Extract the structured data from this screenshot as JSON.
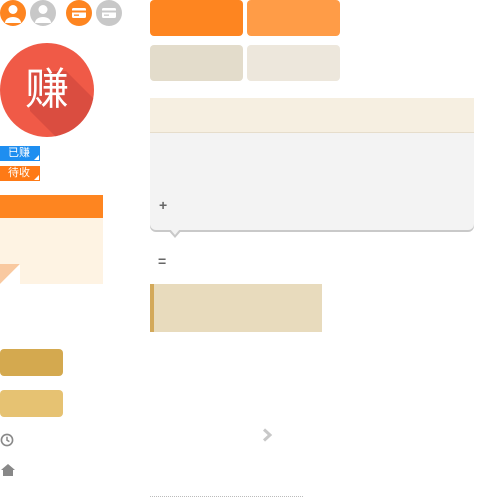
{
  "logo": {
    "character": "赚",
    "bg_color": "#f05a47"
  },
  "tags": [
    {
      "label": "已赚",
      "color": "#1e8ef0"
    },
    {
      "label": "待收",
      "color": "#fe7a16"
    }
  ],
  "top_icons": [
    "user-icon",
    "user-icon",
    "card-icon",
    "card-icon"
  ],
  "tab_buttons": {
    "row1_colors": [
      "#fe8520",
      "#ff9c47"
    ],
    "row2_colors": [
      "#e3dccb",
      "#ede7dc"
    ]
  },
  "card": {
    "plus_symbol": "+",
    "equals_symbol": "="
  },
  "side_buttons": {
    "colors": [
      "#d4a94f",
      "#e6c272"
    ]
  },
  "icons": [
    "clock-icon",
    "home-icon",
    "chevron-right-icon"
  ]
}
